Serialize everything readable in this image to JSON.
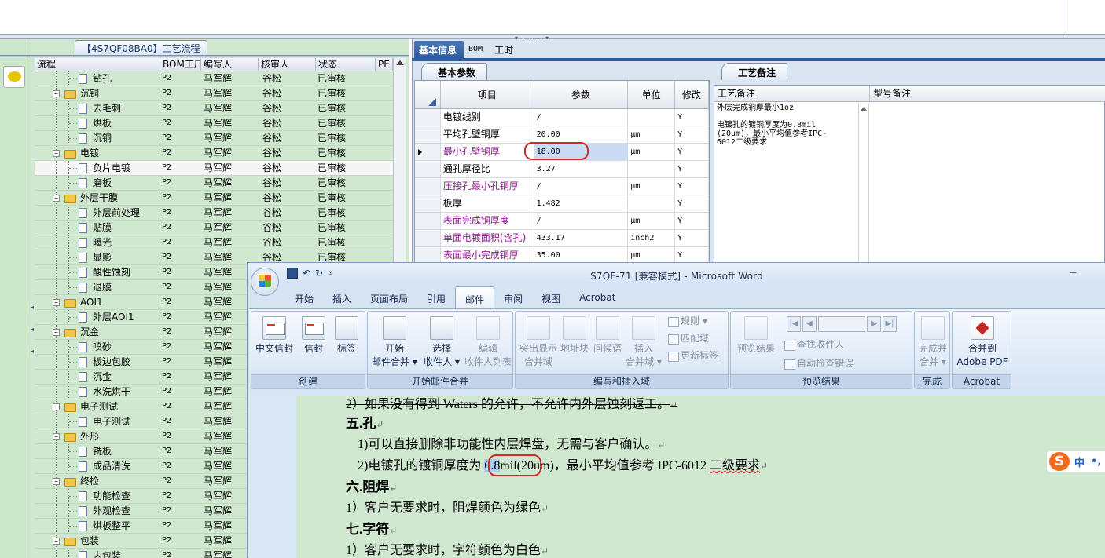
{
  "left_panel": {
    "tab_title": "【4S7QF08BA0】工艺流程",
    "columns": [
      "流程",
      "BOM工厂",
      "编写人",
      "核审人",
      "状态",
      "PE"
    ],
    "rows": [
      {
        "name": "钻孔",
        "level": 2,
        "folder": false,
        "bom": "P2",
        "writer": "马军辉",
        "reviewer": "谷松",
        "status": "已审核"
      },
      {
        "name": "沉铜",
        "level": 1,
        "folder": true,
        "bom": "P2",
        "writer": "马军辉",
        "reviewer": "谷松",
        "status": "已审核"
      },
      {
        "name": "去毛刺",
        "level": 2,
        "folder": false,
        "bom": "P2",
        "writer": "马军辉",
        "reviewer": "谷松",
        "status": "已审核"
      },
      {
        "name": "烘板",
        "level": 2,
        "folder": false,
        "bom": "P2",
        "writer": "马军辉",
        "reviewer": "谷松",
        "status": "已审核"
      },
      {
        "name": "沉铜",
        "level": 2,
        "folder": false,
        "bom": "P2",
        "writer": "马军辉",
        "reviewer": "谷松",
        "status": "已审核"
      },
      {
        "name": "电镀",
        "level": 1,
        "folder": true,
        "bom": "P2",
        "writer": "马军辉",
        "reviewer": "谷松",
        "status": "已审核"
      },
      {
        "name": "负片电镀",
        "level": 2,
        "folder": false,
        "bom": "P2",
        "writer": "马军辉",
        "reviewer": "谷松",
        "status": "已审核",
        "selected": true
      },
      {
        "name": "磨板",
        "level": 2,
        "folder": false,
        "bom": "P2",
        "writer": "马军辉",
        "reviewer": "谷松",
        "status": "已审核"
      },
      {
        "name": "外层干膜",
        "level": 1,
        "folder": true,
        "bom": "P2",
        "writer": "马军辉",
        "reviewer": "谷松",
        "status": "已审核"
      },
      {
        "name": "外层前处理",
        "level": 2,
        "folder": false,
        "bom": "P2",
        "writer": "马军辉",
        "reviewer": "谷松",
        "status": "已审核"
      },
      {
        "name": "贴膜",
        "level": 2,
        "folder": false,
        "bom": "P2",
        "writer": "马军辉",
        "reviewer": "谷松",
        "status": "已审核"
      },
      {
        "name": "曝光",
        "level": 2,
        "folder": false,
        "bom": "P2",
        "writer": "马军辉",
        "reviewer": "谷松",
        "status": "已审核"
      },
      {
        "name": "显影",
        "level": 2,
        "folder": false,
        "bom": "P2",
        "writer": "马军辉",
        "reviewer": "谷松",
        "status": "已审核"
      },
      {
        "name": "酸性蚀刻",
        "level": 2,
        "folder": false,
        "bom": "P2",
        "writer": "马军辉",
        "reviewer": "谷松",
        "status": "已审核"
      },
      {
        "name": "退膜",
        "level": 2,
        "folder": false,
        "bom": "P2",
        "writer": "马军辉",
        "reviewer": "谷松",
        "status": "已审核"
      },
      {
        "name": "AOI1",
        "level": 1,
        "folder": true,
        "bom": "P2",
        "writer": "马军辉",
        "reviewer": "谷松",
        "status": "已审核"
      },
      {
        "name": "外层AOI1",
        "level": 2,
        "folder": false,
        "bom": "P2",
        "writer": "马军辉",
        "reviewer": "谷松",
        "status": "已审核"
      },
      {
        "name": "沉金",
        "level": 1,
        "folder": true,
        "bom": "P2",
        "writer": "马军辉",
        "reviewer": "谷松",
        "status": "已审核"
      },
      {
        "name": "喷砂",
        "level": 2,
        "folder": false,
        "bom": "P2",
        "writer": "马军辉",
        "reviewer": "谷松",
        "status": "已审核"
      },
      {
        "name": "板边包胶",
        "level": 2,
        "folder": false,
        "bom": "P2",
        "writer": "马军辉",
        "reviewer": "谷松",
        "status": "已审核"
      },
      {
        "name": "沉金",
        "level": 2,
        "folder": false,
        "bom": "P2",
        "writer": "马军辉",
        "reviewer": "谷松",
        "status": "已审核"
      },
      {
        "name": "水洗烘干",
        "level": 2,
        "folder": false,
        "bom": "P2",
        "writer": "马军辉",
        "reviewer": "谷松",
        "status": "已审核"
      },
      {
        "name": "电子测试",
        "level": 1,
        "folder": true,
        "bom": "P2",
        "writer": "马军辉",
        "reviewer": "谷松",
        "status": "已审核"
      },
      {
        "name": "电子测试",
        "level": 2,
        "folder": false,
        "bom": "P2",
        "writer": "马军辉",
        "reviewer": "谷松",
        "status": "已审核"
      },
      {
        "name": "外形",
        "level": 1,
        "folder": true,
        "bom": "P2",
        "writer": "马军辉",
        "reviewer": "谷松",
        "status": "已审核"
      },
      {
        "name": "铣板",
        "level": 2,
        "folder": false,
        "bom": "P2",
        "writer": "马军辉",
        "reviewer": "谷松",
        "status": "已审核"
      },
      {
        "name": "成品清洗",
        "level": 2,
        "folder": false,
        "bom": "P2",
        "writer": "马军辉",
        "reviewer": "谷松",
        "status": "已审核"
      },
      {
        "name": "终检",
        "level": 1,
        "folder": true,
        "bom": "P2",
        "writer": "马军辉",
        "reviewer": "谷松",
        "status": "已审核"
      },
      {
        "name": "功能检查",
        "level": 2,
        "folder": false,
        "bom": "P2",
        "writer": "马军辉",
        "reviewer": "谷松",
        "status": "已审核"
      },
      {
        "name": "外观检查",
        "level": 2,
        "folder": false,
        "bom": "P2",
        "writer": "马军辉",
        "reviewer": "谷松",
        "status": "已审核"
      },
      {
        "name": "烘板整平",
        "level": 2,
        "folder": false,
        "bom": "P2",
        "writer": "马军辉",
        "reviewer": "谷松",
        "status": "已审核"
      },
      {
        "name": "包装",
        "level": 1,
        "folder": true,
        "bom": "P2",
        "writer": "马军辉",
        "reviewer": "谷松",
        "status": "已审核"
      },
      {
        "name": "内包装",
        "level": 2,
        "folder": false,
        "bom": "P2",
        "writer": "马军辉",
        "reviewer": "谷松",
        "status": "已审核"
      }
    ]
  },
  "info_panel": {
    "tabs": [
      "基本信息",
      "BOM",
      "工时"
    ],
    "params_tab": "基本参数",
    "notes_tab": "工艺备注",
    "params_columns": [
      "项目",
      "参数",
      "单位",
      "修改"
    ],
    "params": [
      {
        "item": "电镀线别",
        "value": "/",
        "unit": "",
        "mod": "Y",
        "purple": false
      },
      {
        "item": "平均孔壁铜厚",
        "value": "20.00",
        "unit": "μm",
        "mod": "Y",
        "purple": false
      },
      {
        "item": "最小孔壁铜厚",
        "value": "18.00",
        "unit": "μm",
        "mod": "Y",
        "purple": true,
        "current": true
      },
      {
        "item": "通孔厚径比",
        "value": "3.27",
        "unit": "",
        "mod": "Y",
        "purple": false
      },
      {
        "item": "压接孔最小孔铜厚",
        "value": "/",
        "unit": "μm",
        "mod": "Y",
        "purple": true
      },
      {
        "item": "板厚",
        "value": "1.482",
        "unit": "",
        "mod": "Y",
        "purple": false
      },
      {
        "item": "表面完成铜厚度",
        "value": "/",
        "unit": "μm",
        "mod": "Y",
        "purple": true
      },
      {
        "item": "单面电镀面积(含孔)",
        "value": "433.17",
        "unit": "inch2",
        "mod": "Y",
        "purple": true
      },
      {
        "item": "表面最小完成铜厚",
        "value": "35.00",
        "unit": "μm",
        "mod": "Y",
        "purple": true
      }
    ],
    "notes_columns": [
      "工艺备注",
      "型号备注"
    ],
    "notes_text": "外层完成铜厚最小1oz\n\n电镀孔的镀铜厚度为0.8mil\n(20um)，最小平均值参考IPC-\n6012二级要求"
  },
  "word": {
    "title": "S7QF-71 [兼容模式] - Microsoft Word",
    "minimize": "─",
    "qat_undo": "↶",
    "qat_redo": "↻",
    "qat_more": "⩡",
    "tabs": [
      "开始",
      "插入",
      "页面布局",
      "引用",
      "邮件",
      "审阅",
      "视图",
      "Acrobat"
    ],
    "active_tab": 4,
    "groups": {
      "create": {
        "label": "创建",
        "b1": "中文信封",
        "b2": "信封",
        "b3": "标签"
      },
      "start": {
        "label": "开始邮件合并",
        "b1a": "开始",
        "b1b": "邮件合并 ▾",
        "b2a": "选择",
        "b2b": "收件人 ▾",
        "b3a": "编辑",
        "b3b": "收件人列表"
      },
      "insert": {
        "label": "编写和插入域",
        "b1a": "突出显示",
        "b1b": "合并域",
        "b2": "地址块",
        "b3": "问候语",
        "b4a": "插入",
        "b4b": "合并域 ▾",
        "s1": "规则 ▾",
        "s2": "匹配域",
        "s3": "更新标签"
      },
      "preview": {
        "label": "预览结果",
        "b1": "预览结果",
        "s1": "查找收件人",
        "s2": "自动检查错误"
      },
      "finish": {
        "label": "完成",
        "b1a": "完成并",
        "b1b": "合并 ▾"
      },
      "acrobat": {
        "label": "Acrobat",
        "b1a": "合并到",
        "b1b": "Adobe PDF"
      }
    },
    "doc": {
      "line0": "2）如果没有得到 Waters 的允许，不允许内外层蚀刻返工。",
      "h5": "五.孔",
      "line1": "1)可以直接删除非功能性内层焊盘，无需与客户确认。",
      "line2a": "2)电镀孔的镀铜厚度为 ",
      "line2hl": "0.8",
      "line2b": "mil(20um)，最小平均值参考 IPC-6012 ",
      "line2sq": "二级要求",
      "h6": "六.阻焊",
      "line3": "1）客户无要求时，阻焊颜色为绿色",
      "h7": "七.字符",
      "line4": "1）客户无要求时，字符颜色为白色",
      "para": "↵"
    }
  },
  "ime": {
    "logo": "S",
    "lang": "中",
    "extra": "•,"
  }
}
